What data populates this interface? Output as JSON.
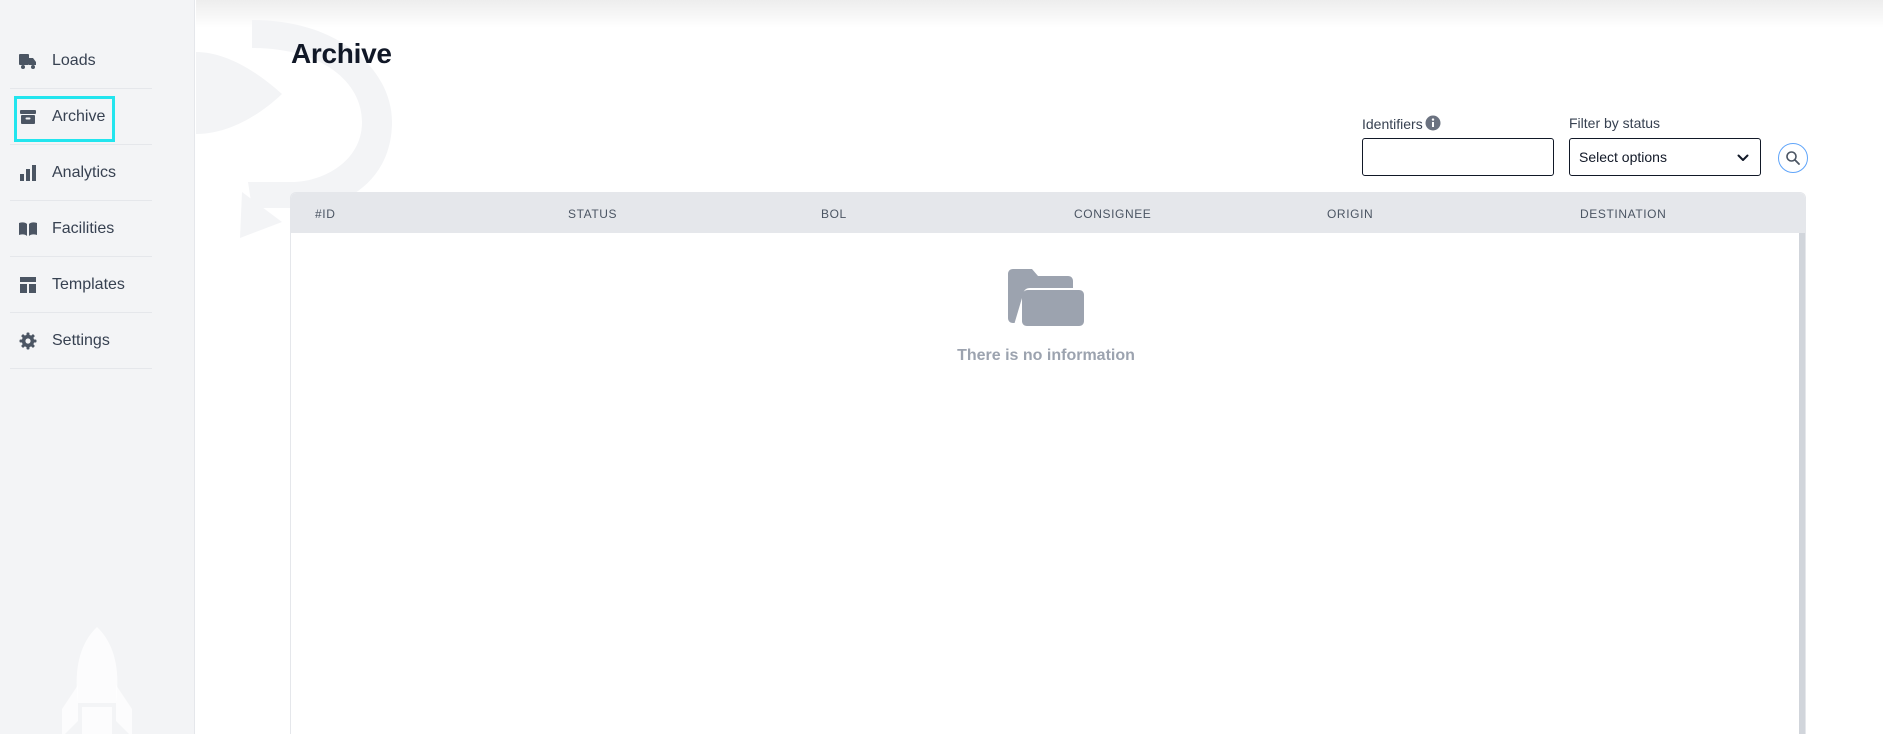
{
  "sidebar": {
    "items": [
      {
        "label": "Loads",
        "icon": "truck-icon"
      },
      {
        "label": "Archive",
        "icon": "archive-box-icon",
        "active": true
      },
      {
        "label": "Analytics",
        "icon": "bar-chart-icon"
      },
      {
        "label": "Facilities",
        "icon": "book-open-icon"
      },
      {
        "label": "Templates",
        "icon": "template-icon"
      },
      {
        "label": "Settings",
        "icon": "gear-icon"
      }
    ]
  },
  "page": {
    "title": "Archive"
  },
  "filters": {
    "identifiers_label": "Identifiers",
    "identifiers_value": "",
    "status_label": "Filter by status",
    "status_placeholder": "Select options"
  },
  "table": {
    "columns": [
      "#ID",
      "STATUS",
      "BOL",
      "CONSIGNEE",
      "ORIGIN",
      "DESTINATION"
    ],
    "rows": [],
    "empty_text": "There is no information"
  },
  "colors": {
    "focus_ring": "#22e5ee",
    "icon_gray": "#4b5563",
    "empty_gray": "#9ca3af",
    "header_bg": "#e5e7eb",
    "search_border": "#60a5fa"
  }
}
